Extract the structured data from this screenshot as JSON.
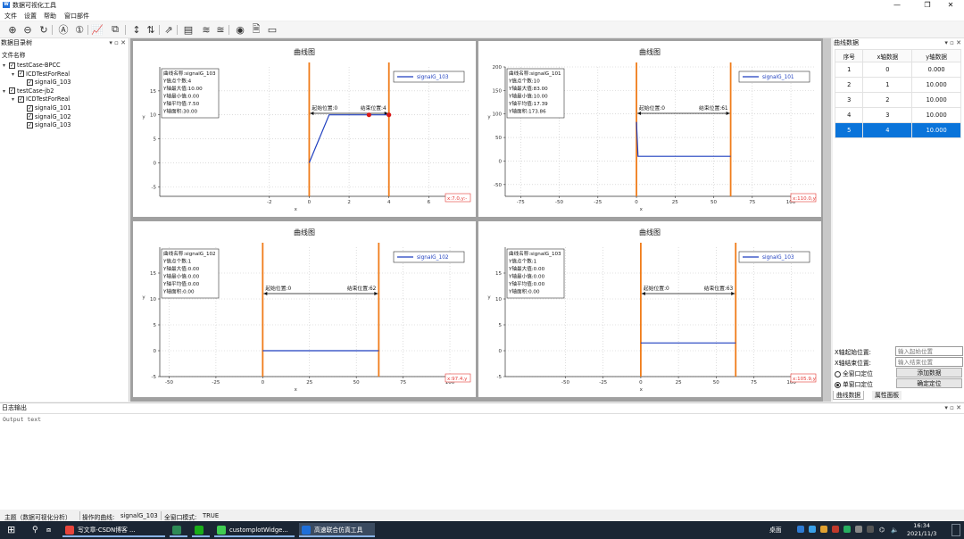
{
  "window": {
    "title": "数据可视化工具",
    "min": "—",
    "max": "❐",
    "close": "✕"
  },
  "menu": [
    "文件",
    "设置",
    "帮助",
    "窗口部件"
  ],
  "toolbar": [
    {
      "name": "zoom-in-icon",
      "glyph": "⊕"
    },
    {
      "name": "zoom-out-icon",
      "glyph": "⊖"
    },
    {
      "name": "refresh-icon",
      "glyph": "↻"
    },
    {
      "name": "all-icon",
      "glyph": "Ⓐ"
    },
    {
      "name": "one-icon",
      "glyph": "①"
    },
    {
      "name": "chart-icon",
      "glyph": "📈"
    },
    {
      "name": "clear-icon",
      "glyph": "⧉"
    },
    {
      "name": "cursor-x-icon",
      "glyph": "↕"
    },
    {
      "name": "cursor-y-icon",
      "glyph": "⇅"
    },
    {
      "name": "export-icon",
      "glyph": "⇗"
    },
    {
      "name": "stack-icon",
      "glyph": "▤"
    },
    {
      "name": "layers-icon",
      "glyph": "≋"
    },
    {
      "name": "layers-off-icon",
      "glyph": "≊"
    },
    {
      "name": "record-icon",
      "glyph": "◉"
    },
    {
      "name": "doc-settings-icon",
      "glyph": "🗎"
    },
    {
      "name": "window-icon",
      "glyph": "▭"
    }
  ],
  "left_dock": {
    "title": "数据目录树",
    "header": "文件名称",
    "filter_placeholder": "输入名称过滤项目",
    "tree": [
      {
        "level": 0,
        "arrow": "▾",
        "label": "testCase-BPCC"
      },
      {
        "level": 1,
        "arrow": "▾",
        "label": "ICDTestForReal"
      },
      {
        "level": 2,
        "arrow": "",
        "label": "signalG_103"
      },
      {
        "level": 0,
        "arrow": "▾",
        "label": "testCase-jb2"
      },
      {
        "level": 1,
        "arrow": "▾",
        "label": "ICDTestForReal"
      },
      {
        "level": 2,
        "arrow": "",
        "label": "signalG_101"
      },
      {
        "level": 2,
        "arrow": "",
        "label": "signalG_102"
      },
      {
        "level": 2,
        "arrow": "",
        "label": "signalG_103"
      }
    ]
  },
  "chart_data": [
    {
      "type": "line",
      "title": "曲线图",
      "xlabel": "x",
      "ylabel": "y",
      "xlim": [
        -7.5,
        8
      ],
      "ylim": [
        -7,
        20
      ],
      "xticks": [
        -2,
        0,
        2,
        4,
        6
      ],
      "yticks": [
        -5,
        0,
        5,
        10,
        15
      ],
      "series": [
        {
          "name": "signalG_103",
          "x": [
            0,
            1,
            2,
            3,
            4
          ],
          "y": [
            0,
            10,
            10,
            10,
            10
          ],
          "color": "#1f3fbf"
        }
      ],
      "points": [
        {
          "x": 3,
          "y": 10
        },
        {
          "x": 4,
          "y": 10
        }
      ],
      "cursor_start": 0,
      "cursor_end": 4,
      "start_label": "起始位置:0",
      "end_label": "结束位置:4",
      "info": [
        "曲线名称:signalG_103",
        "Y值点个数:4",
        "Y轴最大值:10.00",
        "Y轴最小值:0.00",
        "Y轴平均值:7.50",
        "Y轴面积:30.00"
      ],
      "corner": "x:7.0,y:-"
    },
    {
      "type": "line",
      "title": "曲线图",
      "xlabel": "x",
      "ylabel": "y",
      "xlim": [
        -85,
        115
      ],
      "ylim": [
        -75,
        200
      ],
      "xticks": [
        -75,
        -50,
        -25,
        0,
        25,
        50,
        75,
        100
      ],
      "yticks": [
        -50,
        0,
        50,
        100,
        150,
        200
      ],
      "series": [
        {
          "name": "signalG_101",
          "x": [
            0,
            1,
            2,
            61
          ],
          "y": [
            83,
            10,
            10,
            10
          ],
          "color": "#1f3fbf"
        }
      ],
      "points": [],
      "cursor_start": 0,
      "cursor_end": 61,
      "start_label": "起始位置:0",
      "end_label": "结束位置:61",
      "info": [
        "曲线名称:signalG_101",
        "Y值点个数:10",
        "Y轴最大值:83.00",
        "Y轴最小值:10.00",
        "Y轴平均值:17.39",
        "Y轴面积:173.86"
      ],
      "corner": "x:110.0,y"
    },
    {
      "type": "line",
      "title": "曲线图",
      "xlabel": "x",
      "ylabel": "y",
      "xlim": [
        -55,
        110
      ],
      "ylim": [
        -5,
        20
      ],
      "xticks": [
        -50,
        -25,
        0,
        25,
        50,
        75,
        100
      ],
      "yticks": [
        -5,
        0,
        5,
        10,
        15
      ],
      "series": [
        {
          "name": "signalG_102",
          "x": [
            0,
            62
          ],
          "y": [
            0,
            0
          ],
          "color": "#1f3fbf"
        }
      ],
      "points": [],
      "cursor_start": 0,
      "cursor_end": 62,
      "start_label": "起始位置:0",
      "end_label": "结束位置:62",
      "info": [
        "曲线名称:signalG_102",
        "Y值点个数:1",
        "Y轴最大值:0.00",
        "Y轴最小值:0.00",
        "Y轴平均值:0.00",
        "Y轴面积:0.00"
      ],
      "corner": "x:97.4,y"
    },
    {
      "type": "line",
      "title": "曲线图",
      "xlabel": "x",
      "ylabel": "y",
      "xlim": [
        -90,
        115
      ],
      "ylim": [
        -5,
        20
      ],
      "xticks": [
        -50,
        -25,
        0,
        25,
        50,
        75,
        100
      ],
      "yticks": [
        -5,
        0,
        5,
        10,
        15
      ],
      "series": [
        {
          "name": "signalG_103",
          "x": [
            0,
            63
          ],
          "y": [
            1.5,
            1.5
          ],
          "color": "#1f3fbf"
        }
      ],
      "points": [],
      "cursor_start": 0,
      "cursor_end": 63,
      "start_label": "起始位置:0",
      "end_label": "结束位置:63",
      "info": [
        "曲线名称:signalG_103",
        "Y值点个数:1",
        "Y轴最大值:0.00",
        "Y轴最小值:0.00",
        "Y轴平均值:0.00",
        "Y轴面积:0.00"
      ],
      "corner": "x:105.9,y"
    }
  ],
  "right_dock": {
    "title": "曲线数据",
    "columns": [
      "序号",
      "x轴数据",
      "y轴数据"
    ],
    "rows": [
      [
        "1",
        "0",
        "0.000"
      ],
      [
        "2",
        "1",
        "10.000"
      ],
      [
        "3",
        "2",
        "10.000"
      ],
      [
        "4",
        "3",
        "10.000"
      ],
      [
        "5",
        "4",
        "10.000"
      ]
    ],
    "selected_row": 4,
    "x_start_label": "X轴起始位置:",
    "x_start_placeholder": "输入起始位置",
    "x_end_label": "X轴结束位置:",
    "x_end_placeholder": "输入结束位置",
    "radio_all": "全窗口定位",
    "radio_single": "单窗口定位",
    "btn_add": "添加数据",
    "btn_locate": "确定定位",
    "tab_curve": "曲线数据",
    "tab_attr": "属性面板"
  },
  "log": {
    "title": "日志输出",
    "text": "Output text"
  },
  "status": {
    "theme": "主题（数据可视化分析）",
    "curve_label": "操作的曲线:",
    "curve_value": "signalG_103",
    "mode_label": "全窗口模式:",
    "mode_value": "TRUE"
  },
  "taskbar": {
    "search_placeholder": "",
    "apps": [
      {
        "label": "写文章-CSDN博客 ...",
        "color": "#e8453c"
      },
      {
        "label": "",
        "color": "#2e8b57"
      },
      {
        "label": "",
        "color": "#1aad19"
      },
      {
        "label": "customplotWidge...",
        "color": "#41cd52"
      },
      {
        "label": "高速联合仿真工具",
        "color": "#1e6fd9"
      }
    ],
    "desktop": "桌面",
    "time": "16:34",
    "date": "2021/11/3"
  }
}
